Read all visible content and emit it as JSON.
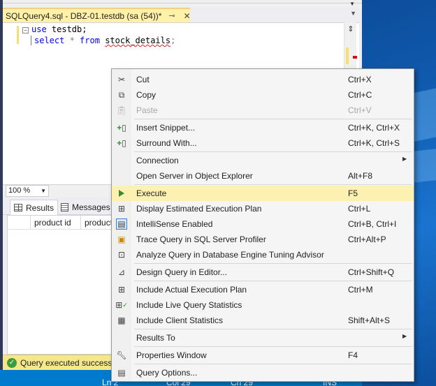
{
  "colors": {
    "accent_blue": "#007acc",
    "tab_yellow": "#fff1a8",
    "highlight_yellow": "#fcf1b0",
    "keyword_blue": "#0000ff",
    "success_green": "#3c9b3c"
  },
  "tab": {
    "title": "SQLQuery4.sql - DBZ-01.testdb (sa (54))*",
    "pin_icon": "pin-icon",
    "close_icon": "close-icon"
  },
  "editor": {
    "line1": {
      "keyword": "use",
      "text": " testdb;"
    },
    "line2": {
      "keyword1": "select",
      "op": " * ",
      "keyword2": "from",
      "space": " ",
      "table": "stock_details",
      "end": ";"
    }
  },
  "zoom": {
    "value": "100 %"
  },
  "results": {
    "tab_results": "Results",
    "tab_messages": "Messages",
    "columns": [
      "product id",
      "product n"
    ]
  },
  "status": {
    "query_message": "Query executed successfully.",
    "ln": "Ln 2",
    "col": "Col 29",
    "ch": "Ch 29",
    "ins": "INS"
  },
  "context_menu": {
    "items": [
      {
        "label": "Cut",
        "shortcut": "Ctrl+X",
        "icon": "scissors-icon",
        "disabled": false
      },
      {
        "label": "Copy",
        "shortcut": "Ctrl+C",
        "icon": "copy-icon",
        "disabled": false
      },
      {
        "label": "Paste",
        "shortcut": "Ctrl+V",
        "icon": "paste-icon",
        "disabled": true
      },
      {
        "label": "Insert Snippet...",
        "shortcut": "Ctrl+K, Ctrl+X",
        "icon": "insert-snippet-icon",
        "disabled": false
      },
      {
        "label": "Surround With...",
        "shortcut": "Ctrl+K, Ctrl+S",
        "icon": "surround-with-icon",
        "disabled": false
      },
      {
        "label": "Connection",
        "shortcut": "",
        "icon": "",
        "submenu": true
      },
      {
        "label": "Open Server in Object Explorer",
        "shortcut": "Alt+F8",
        "icon": ""
      },
      {
        "label": "Execute",
        "shortcut": "F5",
        "icon": "execute-icon",
        "highlight": true
      },
      {
        "label": "Display Estimated Execution Plan",
        "shortcut": "Ctrl+L",
        "icon": "estimated-plan-icon"
      },
      {
        "label": "IntelliSense Enabled",
        "shortcut": "Ctrl+B, Ctrl+I",
        "icon": "intellisense-icon"
      },
      {
        "label": "Trace Query in SQL Server Profiler",
        "shortcut": "Ctrl+Alt+P",
        "icon": "profiler-icon"
      },
      {
        "label": "Analyze Query in Database Engine Tuning Advisor",
        "shortcut": "",
        "icon": "tuning-advisor-icon"
      },
      {
        "label": "Design Query in Editor...",
        "shortcut": "Ctrl+Shift+Q",
        "icon": "design-query-icon"
      },
      {
        "label": "Include Actual Execution Plan",
        "shortcut": "Ctrl+M",
        "icon": "actual-plan-icon"
      },
      {
        "label": "Include Live Query Statistics",
        "shortcut": "",
        "icon": "live-stats-icon"
      },
      {
        "label": "Include Client Statistics",
        "shortcut": "Shift+Alt+S",
        "icon": "client-stats-icon"
      },
      {
        "label": "Results To",
        "shortcut": "",
        "icon": "",
        "submenu": true
      },
      {
        "label": "Properties Window",
        "shortcut": "F4",
        "icon": "wrench-icon"
      },
      {
        "label": "Query Options...",
        "shortcut": "",
        "icon": "query-options-icon"
      }
    ]
  }
}
